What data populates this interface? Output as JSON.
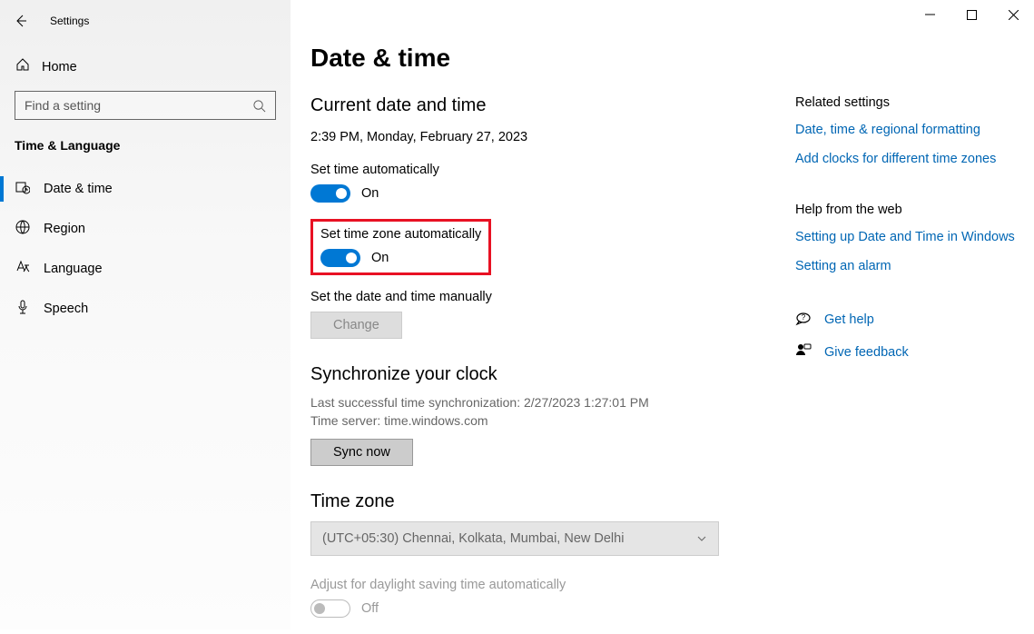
{
  "window": {
    "title": "Settings"
  },
  "sidebar": {
    "home": "Home",
    "searchPlaceholder": "Find a setting",
    "category": "Time & Language",
    "items": [
      {
        "label": "Date & time"
      },
      {
        "label": "Region"
      },
      {
        "label": "Language"
      },
      {
        "label": "Speech"
      }
    ]
  },
  "page": {
    "title": "Date & time",
    "currentHeading": "Current date and time",
    "currentValue": "2:39 PM, Monday, February 27, 2023",
    "setTimeAuto": {
      "label": "Set time automatically",
      "state": "On"
    },
    "setTzAuto": {
      "label": "Set time zone automatically",
      "state": "On"
    },
    "manual": {
      "label": "Set the date and time manually",
      "button": "Change"
    },
    "sync": {
      "heading": "Synchronize your clock",
      "lastSync": "Last successful time synchronization: 2/27/2023 1:27:01 PM",
      "server": "Time server: time.windows.com",
      "button": "Sync now"
    },
    "tz": {
      "heading": "Time zone",
      "value": "(UTC+05:30) Chennai, Kolkata, Mumbai, New Delhi"
    },
    "dst": {
      "label": "Adjust for daylight saving time automatically",
      "state": "Off"
    }
  },
  "related": {
    "heading": "Related settings",
    "links": [
      "Date, time & regional formatting",
      "Add clocks for different time zones"
    ]
  },
  "help": {
    "heading": "Help from the web",
    "links": [
      "Setting up Date and Time in Windows",
      "Setting an alarm"
    ],
    "getHelp": "Get help",
    "feedback": "Give feedback"
  }
}
